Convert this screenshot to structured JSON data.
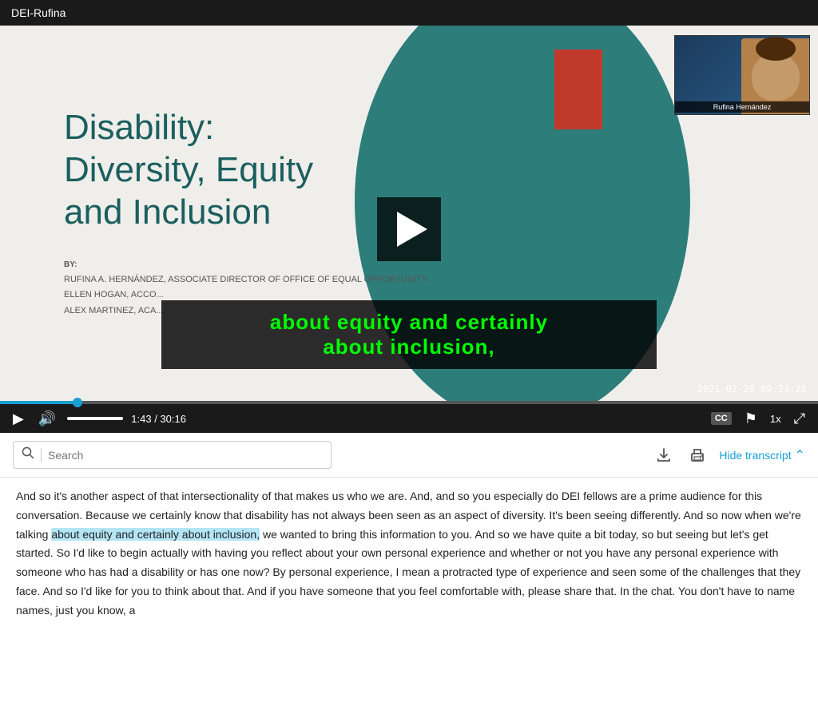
{
  "titleBar": {
    "text": "DEI-Rufina"
  },
  "video": {
    "slide": {
      "title": "Disability:\nDiversity, Equity\nand Inclusion",
      "by_label": "BY:",
      "presenters": [
        "RUFINA A. HERNÁNDEZ, ASSOCIATE DIRECTOR OF  OFFICE OF EQUAL OPPORTUNITY",
        "ELLEN HOGAN, ACCO...",
        "ALEX MARTINEZ, ACA..."
      ]
    },
    "caption": {
      "line1": "about equity and certainly",
      "line2": "about inclusion,"
    },
    "timestamp": "2021-02-26  09:24:26",
    "speaker": {
      "name": "Rufina Hernández"
    },
    "controls": {
      "play_icon": "▶",
      "volume_icon": "🔊",
      "time_current": "1:43",
      "time_separator": "/",
      "time_total": "30:16",
      "cc_label": "CC",
      "flag_icon": "⚑",
      "speed_label": "1x",
      "fullscreen_icon": "⤢",
      "progress_percent": 9.6
    }
  },
  "transcriptToolbar": {
    "search_placeholder": "Search",
    "hide_transcript_label": "Hide transcript",
    "download_icon": "download-icon",
    "print_icon": "print-icon"
  },
  "transcript": {
    "text_before": "And so it's another aspect of that intersectionality of that makes us who we are. And, and so you especially do DEI fellows are a prime audience for this conversation. Because we certainly know that disability has not always been seen as an aspect of diversity. It's been seeing differently. And so now when we're talking ",
    "highlighted": "about equity and certainly about inclusion,",
    "text_after": " we wanted to bring this information to you. And so we have quite a bit today, so but seeing but let's get started. So I'd like to begin actually with having you reflect about your own personal experience and whether or not you have any personal experience with someone who has had a disability or has one now? By personal experience, I mean a protracted type of experience and seen some of the challenges that they face. And so I'd like for you to think about that. And if you have someone that you feel comfortable with, please share that. In the chat. You don't have to name names, just you know, a"
  }
}
